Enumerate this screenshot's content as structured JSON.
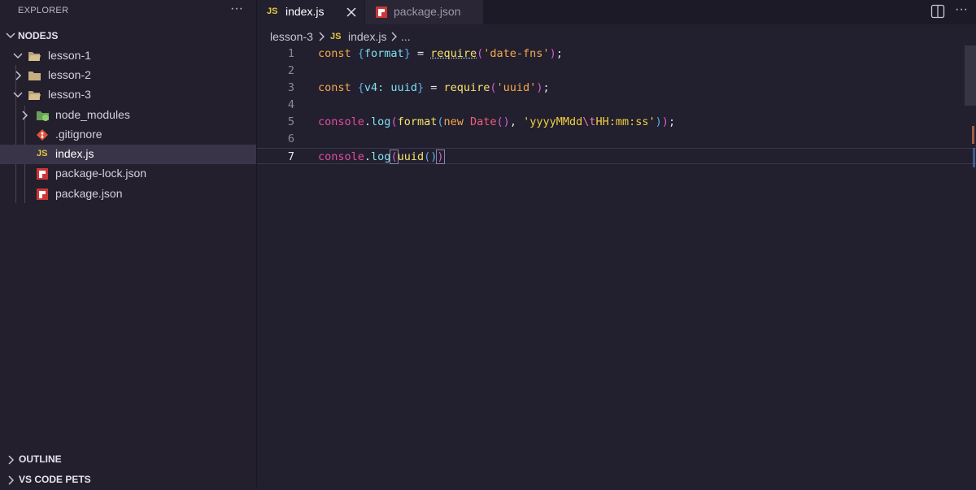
{
  "sidebar": {
    "title": "EXPLORER",
    "more": "···",
    "root": "NODEJS",
    "items": [
      {
        "label": "lesson-1",
        "type": "folder"
      },
      {
        "label": "lesson-2",
        "type": "folder"
      },
      {
        "label": "lesson-3",
        "type": "folder"
      },
      {
        "label": "node_modules",
        "type": "folder"
      },
      {
        "label": ".gitignore",
        "type": "file"
      },
      {
        "label": "index.js",
        "type": "file",
        "badge": "JS"
      },
      {
        "label": "package-lock.json",
        "type": "file"
      },
      {
        "label": "package.json",
        "type": "file"
      }
    ],
    "sections": [
      {
        "label": "OUTLINE"
      },
      {
        "label": "VS CODE PETS"
      }
    ]
  },
  "tabs": [
    {
      "label": "index.js",
      "badge": "JS",
      "active": true
    },
    {
      "label": "package.json",
      "active": false
    }
  ],
  "tab_actions": {
    "more": "···"
  },
  "breadcrumb": {
    "folder": "lesson-3",
    "badge": "JS",
    "file": "index.js",
    "rest": "..."
  },
  "editor": {
    "line_numbers": [
      "1",
      "2",
      "3",
      "4",
      "5",
      "6",
      "7"
    ],
    "current_line": "7",
    "code": {
      "l1": {
        "kw": "const",
        "b1": "{",
        "prop": "format",
        "b2": "}",
        "eq": " = ",
        "fn": "require",
        "p1": "(",
        "str": "'date-fns'",
        "p2": ")",
        "end": ";"
      },
      "l3": {
        "kw": "const",
        "b1": "{",
        "prop": "v4: uuid",
        "b2": "}",
        "eq": " = ",
        "fn": "require",
        "p1": "(",
        "str": "'uuid'",
        "p2": ")",
        "end": ";"
      },
      "l5": {
        "obj": "console",
        "dot": ".",
        "meth": "log",
        "p1": "(",
        "fn": "format",
        "p2": "(",
        "kw": "new",
        "cls": "Date",
        "p3": "()",
        "comma": ", ",
        "s1": "'yyyyMMdd",
        "esc": "\\t",
        "s2": "HH:mm:ss'",
        "p4": ")",
        "p5": ")",
        "end": ";"
      },
      "l7": {
        "obj": "console",
        "dot": ".",
        "meth": "log",
        "p1": "(",
        "fn": "uuid",
        "p2": "()",
        "p3": ")"
      }
    }
  },
  "colors": {
    "background": "#221f2e",
    "sidebar": "#231f2c",
    "js_badge": "#e5c844",
    "npm_red": "#cb3837"
  }
}
